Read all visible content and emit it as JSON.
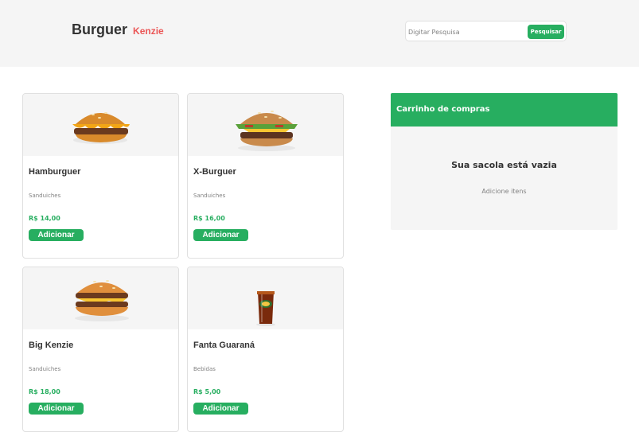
{
  "header": {
    "logo_main": "Burguer",
    "logo_accent": "Kenzie",
    "search_placeholder": "Digitar Pesquisa",
    "search_button": "Pesquisar"
  },
  "products": [
    {
      "name": "Hamburguer",
      "category": "Sanduiches",
      "price": "R$ 14,00",
      "button": "Adicionar",
      "image": "burger-icon"
    },
    {
      "name": "X-Burguer",
      "category": "Sanduiches",
      "price": "R$ 16,00",
      "button": "Adicionar",
      "image": "cheeseburger-icon"
    },
    {
      "name": "Big Kenzie",
      "category": "Sanduiches",
      "price": "R$ 18,00",
      "button": "Adicionar",
      "image": "big-burger-icon"
    },
    {
      "name": "Fanta Guaraná",
      "category": "Bebidas",
      "price": "R$ 5,00",
      "button": "Adicionar",
      "image": "soda-cup-icon"
    }
  ],
  "cart": {
    "title": "Carrinho de compras",
    "empty_title": "Sua sacola está vazia",
    "empty_subtitle": "Adicione itens"
  },
  "colors": {
    "primary": "#27ae60",
    "accent": "#eb5757",
    "header_bg": "#f5f5f5",
    "text": "#333333",
    "muted": "#828282"
  }
}
